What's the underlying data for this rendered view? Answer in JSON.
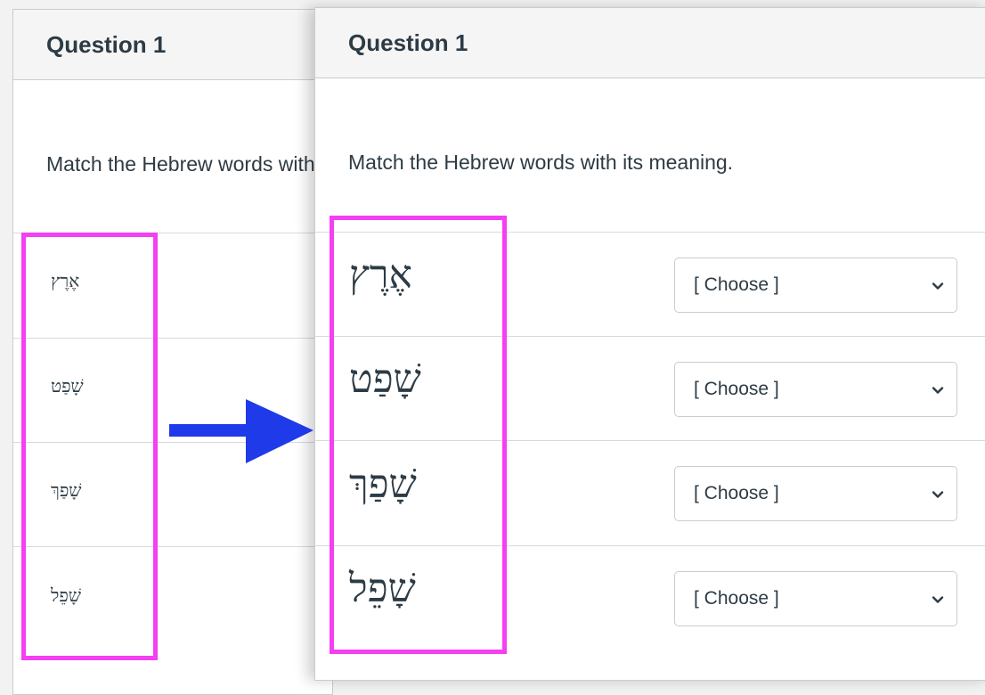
{
  "left_panel": {
    "title": "Question 1",
    "prompt": "Match the Hebrew words with its meaning.",
    "words": [
      "אֶרֶץ",
      "שָׁפַט",
      "שָׁפַךְ",
      "שָׁפֵל"
    ]
  },
  "right_panel": {
    "title": "Question 1",
    "prompt": "Match the Hebrew words with its meaning.",
    "rows": [
      {
        "word": "אֶרֶץ",
        "selected": "[ Choose ]"
      },
      {
        "word": "שָׁפַט",
        "selected": "[ Choose ]"
      },
      {
        "word": "שָׁפַךְ",
        "selected": "[ Choose ]"
      },
      {
        "word": "שָׁפֵל",
        "selected": "[ Choose ]"
      }
    ]
  },
  "annotations": {
    "highlight_color": "#f43ff2",
    "arrow_color": "#1f3ae8",
    "arrow_icon": "arrow-right-icon"
  }
}
